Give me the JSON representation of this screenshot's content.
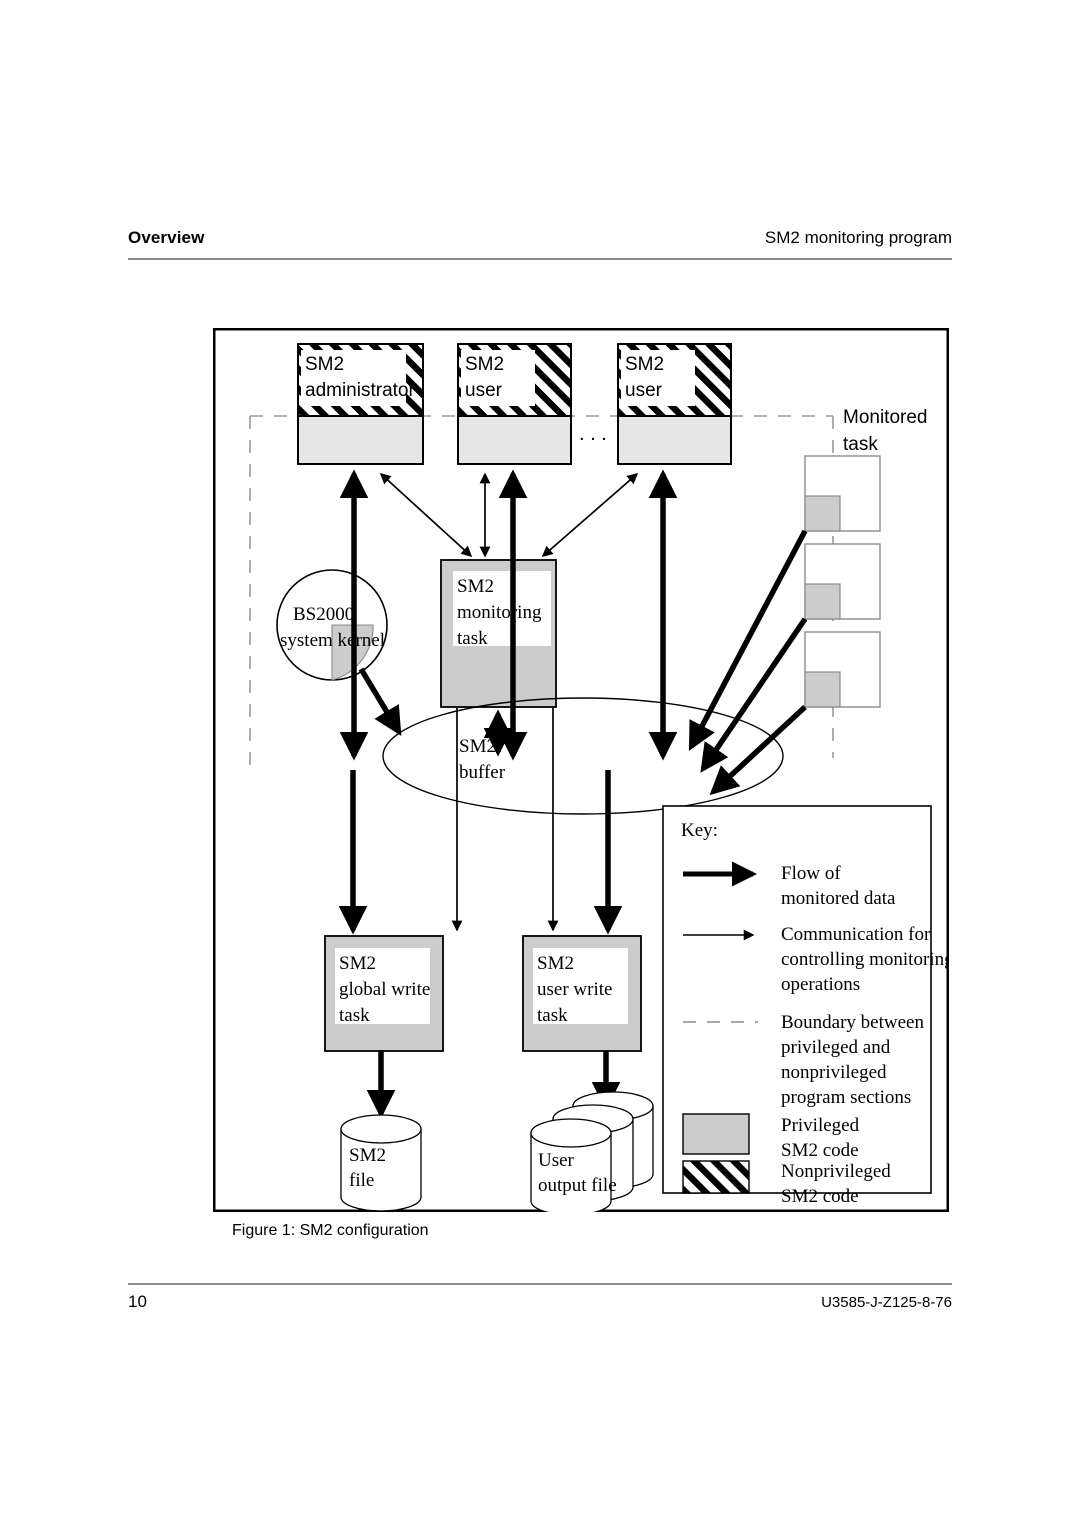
{
  "header": {
    "left": "Overview",
    "right": "SM2 monitoring program"
  },
  "footer": {
    "page_number": "10",
    "doc_id": "U3585-J-Z125-8-76"
  },
  "figure": {
    "caption": "Figure 1: SM2 configuration",
    "nodes": {
      "sm2_administrator": {
        "line1": "SM2",
        "line2": "administrator"
      },
      "sm2_user_1": {
        "line1": "SM2",
        "line2": "user"
      },
      "sm2_user_2": {
        "line1": "SM2",
        "line2": "user"
      },
      "ellipsis": ". . .",
      "monitored_task": {
        "line1": "Monitored",
        "line2": "task"
      },
      "bs2000_kernel": {
        "line1": "BS2000",
        "line2": "system kernel"
      },
      "sm2_monitoring_task": {
        "line1": "SM2",
        "line2": "monitoring",
        "line3": "task"
      },
      "sm2_buffer": {
        "line1": "SM2",
        "line2": "buffer"
      },
      "sm2_global_write_task": {
        "line1": "SM2",
        "line2": "global write",
        "line3": "task"
      },
      "sm2_user_write_task": {
        "line1": "SM2",
        "line2": "user write",
        "line3": "task"
      },
      "sm2_file": {
        "line1": "SM2",
        "line2": "file"
      },
      "user_output_file": {
        "line1": "User",
        "line2": "output file"
      }
    },
    "key": {
      "title": "Key:",
      "items": [
        {
          "symbol": "thick-arrow",
          "line1": "Flow of",
          "line2": "monitored data",
          "line3": "",
          "line4": ""
        },
        {
          "symbol": "thin-arrow",
          "line1": "Communication for",
          "line2": "controlling   monitoring",
          "line3": "operations",
          "line4": ""
        },
        {
          "symbol": "dashed-line",
          "line1": "Boundary  between",
          "line2": "privileged and",
          "line3": "nonprivileged",
          "line4": "program sections"
        },
        {
          "symbol": "gray-swatch",
          "line1": "Privileged",
          "line2": "SM2 code",
          "line3": "",
          "line4": ""
        },
        {
          "symbol": "hatched-swatch",
          "line1": "Nonprivileged",
          "line2": "SM2 code",
          "line3": "",
          "line4": ""
        }
      ]
    },
    "colors": {
      "privileged_fill": "#cccccc",
      "task_fill": "#e6e6e6",
      "boundary": "#9a9a9a",
      "stroke": "#000000"
    }
  }
}
